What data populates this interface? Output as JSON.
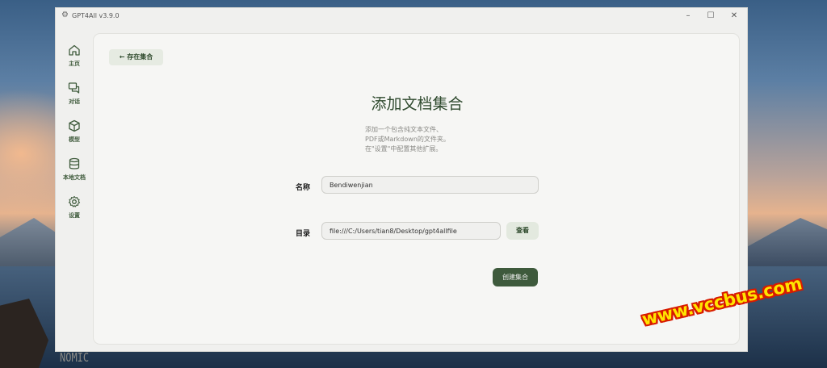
{
  "window": {
    "title": "GPT4All v3.9.0"
  },
  "sidebar": {
    "items": [
      {
        "label": "主页",
        "icon": "home-icon"
      },
      {
        "label": "对话",
        "icon": "chat-icon"
      },
      {
        "label": "模型",
        "icon": "cube-icon"
      },
      {
        "label": "本地文档",
        "icon": "database-icon"
      },
      {
        "label": "设置",
        "icon": "gear-icon"
      }
    ],
    "brand": "NOMIC"
  },
  "panel": {
    "back_label": "← 存在集合",
    "title": "添加文档集合",
    "description_lines": [
      "添加一个包含纯文本文件、",
      "PDF或Markdown的文件夹。",
      "在\"设置\"中配置其他扩展。"
    ],
    "name_label": "名称",
    "name_value": "Bendiwenjian",
    "folder_label": "目录",
    "folder_value": "file:///C:/Users/tian8/Desktop/gpt4allfile",
    "browse_label": "查看",
    "create_label": "创建集合"
  },
  "watermark": "www.vccbus.com",
  "colors": {
    "accent": "#3e5a3c",
    "accent_light": "#e3e9df",
    "panel_bg": "#f6f6f4"
  }
}
